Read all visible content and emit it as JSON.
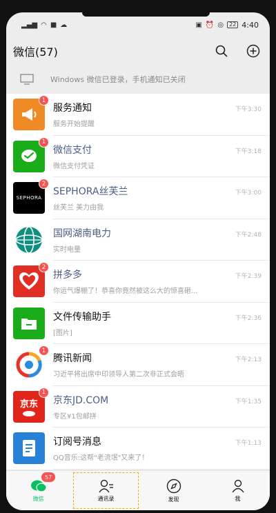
{
  "status_bar": {
    "time": "4:40",
    "battery": "22"
  },
  "header": {
    "title": "微信(57)"
  },
  "notice": {
    "text": "Windows 微信已登录，手机通知已关闭"
  },
  "chats": [
    {
      "name": "服务通知",
      "message": "服务开始提醒",
      "time": "下午3:30",
      "badge": "1",
      "brand": false
    },
    {
      "name": "微信支付",
      "message": "微信支付凭证",
      "time": "下午3:18",
      "badge": "1",
      "brand": true
    },
    {
      "name": "SEPHORA丝芙兰",
      "message": "丝芙兰 美力由我",
      "time": "下午3:00",
      "badge": "2",
      "brand": true,
      "logo_text": "SEPHORA"
    },
    {
      "name": "国网湖南电力",
      "message": "实时电量",
      "time": "下午2:48",
      "badge": "",
      "brand": true
    },
    {
      "name": "拼多多",
      "message": "你运气爆棚了！恭喜你竟然被这么大的惊喜砸...",
      "time": "下午2:39",
      "badge": "2",
      "brand": true
    },
    {
      "name": "文件传输助手",
      "message": "[图片]",
      "time": "下午2:36",
      "badge": "",
      "brand": false
    },
    {
      "name": "腾讯新闻",
      "message": "习近平将出席中印领导人第二次非正式会晤",
      "time": "下午2:13",
      "badge": "1",
      "brand": false
    },
    {
      "name": "京东JD.COM",
      "message": "专区¥1包邮拼",
      "time": "下午1:35",
      "badge": "1",
      "brand": true,
      "logo_text": "京东"
    },
    {
      "name": "订阅号消息",
      "message": "QQ音乐:这帮\"老流氓\"又来了！",
      "time": "下午1:13",
      "badge": "",
      "brand": false
    }
  ],
  "tabs": [
    {
      "label": "微信",
      "badge": "57"
    },
    {
      "label": "通讯录"
    },
    {
      "label": "发现"
    },
    {
      "label": "我"
    }
  ],
  "colors": {
    "accent": "#07c160",
    "badge": "#fa5151",
    "brand_name": "#4a5d87"
  }
}
